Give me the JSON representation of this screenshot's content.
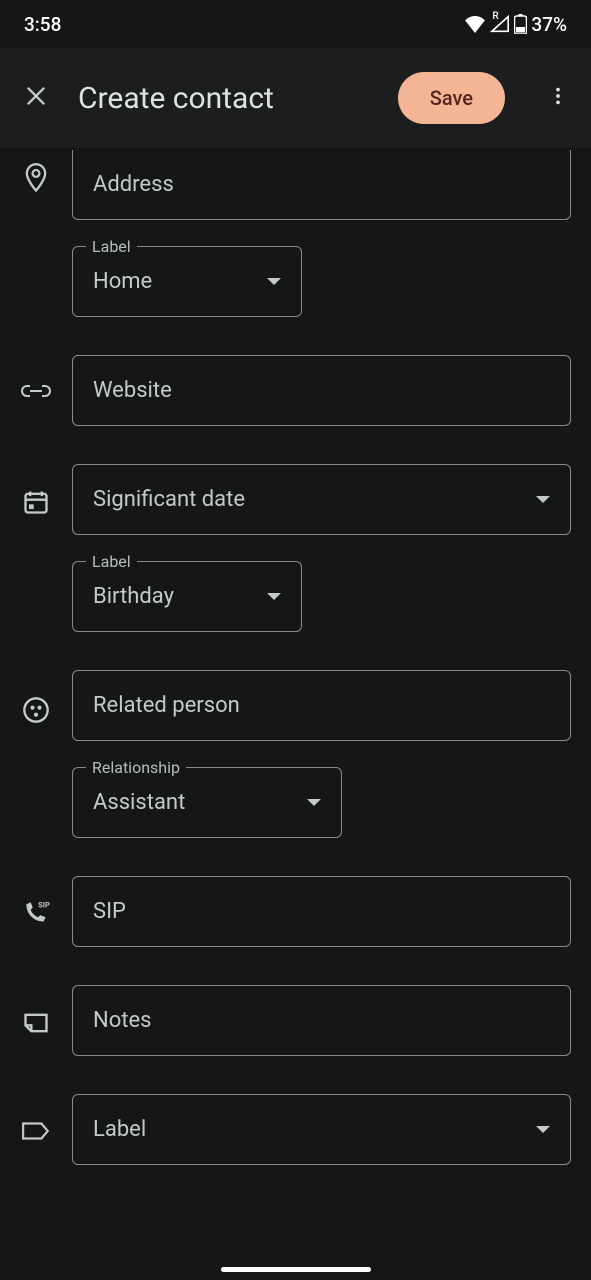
{
  "status_bar": {
    "time": "3:58",
    "battery_percent": "37%",
    "roaming_indicator": "R"
  },
  "app_bar": {
    "title": "Create contact",
    "save_label": "Save"
  },
  "fields": {
    "address": {
      "placeholder": "Address",
      "label_field_label": "Label",
      "label_value": "Home"
    },
    "website": {
      "placeholder": "Website"
    },
    "significant_date": {
      "placeholder": "Significant date",
      "label_field_label": "Label",
      "label_value": "Birthday"
    },
    "related_person": {
      "placeholder": "Related person",
      "relationship_field_label": "Relationship",
      "relationship_value": "Assistant"
    },
    "sip": {
      "placeholder": "SIP"
    },
    "notes": {
      "placeholder": "Notes"
    },
    "label": {
      "placeholder": "Label"
    }
  }
}
